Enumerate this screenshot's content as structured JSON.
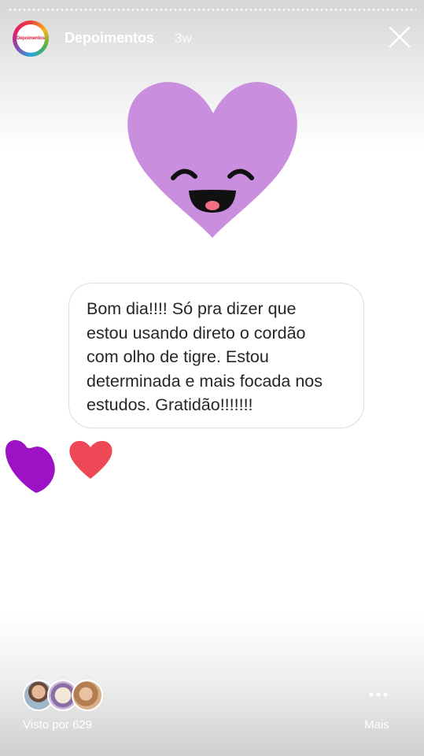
{
  "story": {
    "progress": 1.0,
    "account_name": "Depoimentos",
    "avatar_label": "Depoimentos",
    "posted_ago": "3w",
    "close_icon": "close-icon"
  },
  "stickers": {
    "main": "smiling-heart-sticker",
    "reactions": [
      "purple-heart-reaction",
      "red-heart-reaction"
    ]
  },
  "message": {
    "text": "Bom dia!!!! Só pra dizer que\nestou usando direto o cordão\ncom olho de tigre. Estou\ndeterminada e mais focada nos\nestudos. Gratidão!!!!!!!"
  },
  "footer": {
    "seen_by": "Visto por 629",
    "more_label": "Mais",
    "more_icon": "ellipsis-icon"
  },
  "colors": {
    "heart_lilac": "#c98ede",
    "heart_purple": "#9c12c4",
    "heart_red": "#ee4856"
  }
}
